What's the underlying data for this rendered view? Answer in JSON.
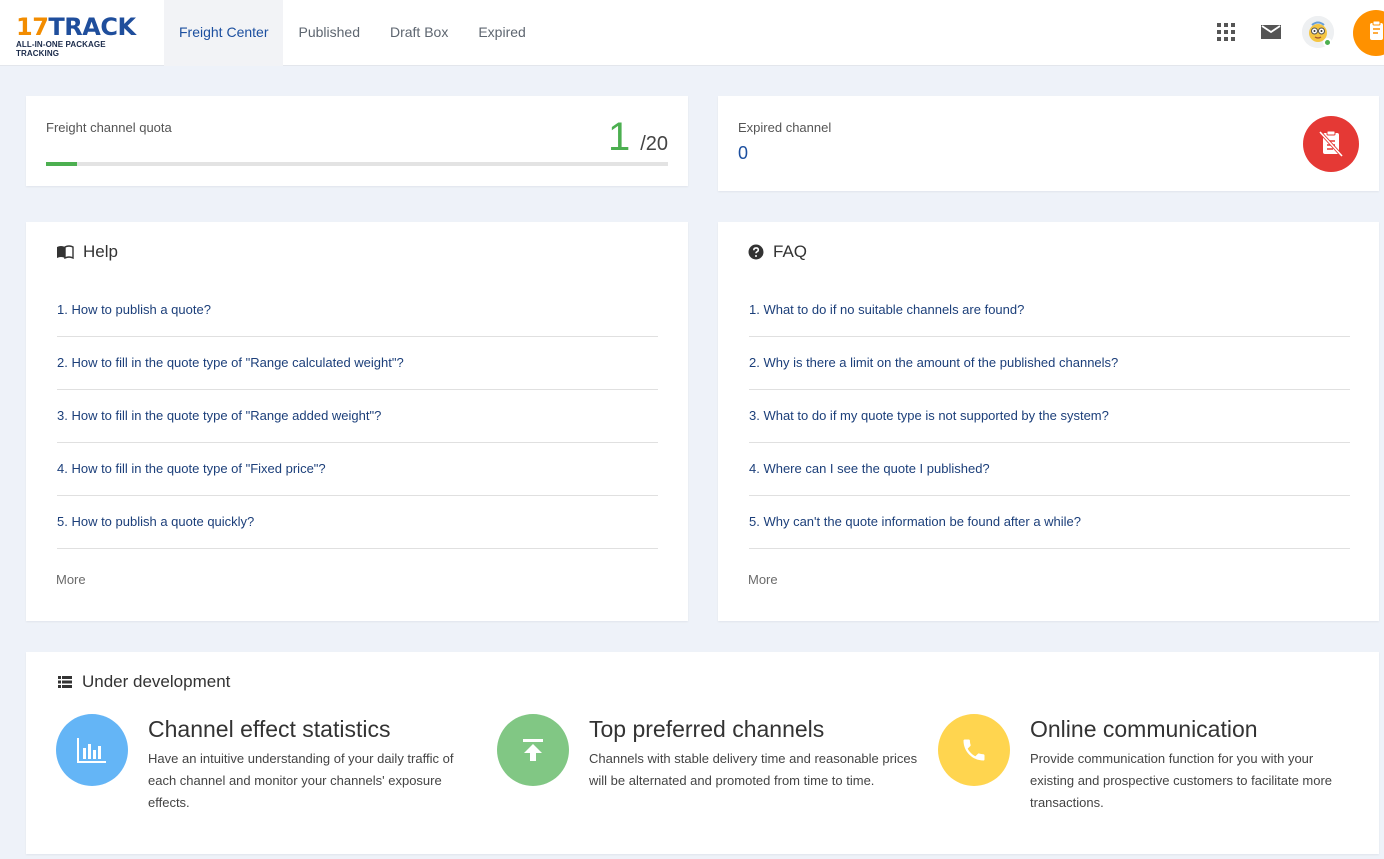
{
  "brand": {
    "logo_number": "17",
    "logo_word": "TRACK",
    "logo_tagline": "ALL-IN-ONE PACKAGE TRACKING"
  },
  "nav": {
    "tabs": [
      {
        "label": "Freight Center",
        "active": true
      },
      {
        "label": "Published",
        "active": false
      },
      {
        "label": "Draft Box",
        "active": false
      },
      {
        "label": "Expired",
        "active": false
      }
    ]
  },
  "header_icons": [
    "apps-grid-icon",
    "mail-icon",
    "user-avatar",
    "clipboard-icon"
  ],
  "quota": {
    "label": "Freight channel quota",
    "used": "1",
    "total": "/20",
    "progress_fraction": 0.05
  },
  "expired": {
    "label": "Expired channel",
    "value": "0"
  },
  "help": {
    "title": "Help",
    "items": [
      "1. How to publish a quote?",
      "2. How to fill in the quote type of \"Range calculated weight\"?",
      "3. How to fill in the quote type of \"Range added weight\"?",
      "4. How to fill in the quote type of \"Fixed price\"?",
      "5. How to publish a quote quickly?"
    ],
    "more": "More"
  },
  "faq": {
    "title": "FAQ",
    "items": [
      "1. What to do if no suitable channels are found?",
      "2. Why is there a limit on the amount of the published channels?",
      "3. What to do if my quote type is not supported by the system?",
      "4. Where can I see the quote I published?",
      "5. Why can't the quote information be found after a while?"
    ],
    "more": "More"
  },
  "development": {
    "title": "Under development",
    "features": [
      {
        "title": "Channel effect statistics",
        "description": "Have an intuitive understanding of your daily traffic of each channel and monitor your channels' exposure effects.",
        "icon": "bar-chart-icon",
        "color": "#64b5f6"
      },
      {
        "title": "Top preferred channels",
        "description": "Channels with stable delivery time and reasonable prices will be alternated and promoted from time to time.",
        "icon": "upload-top-icon",
        "color": "#81c784"
      },
      {
        "title": "Online communication",
        "description": "Provide communication function for you with your existing and prospective customers to facilitate more transactions.",
        "icon": "phone-icon",
        "color": "#ffd54f"
      }
    ]
  },
  "colors": {
    "brand_blue": "#1f4e9c",
    "brand_orange": "#f28c00",
    "progress_green": "#4caf50",
    "expired_red": "#e53935"
  }
}
